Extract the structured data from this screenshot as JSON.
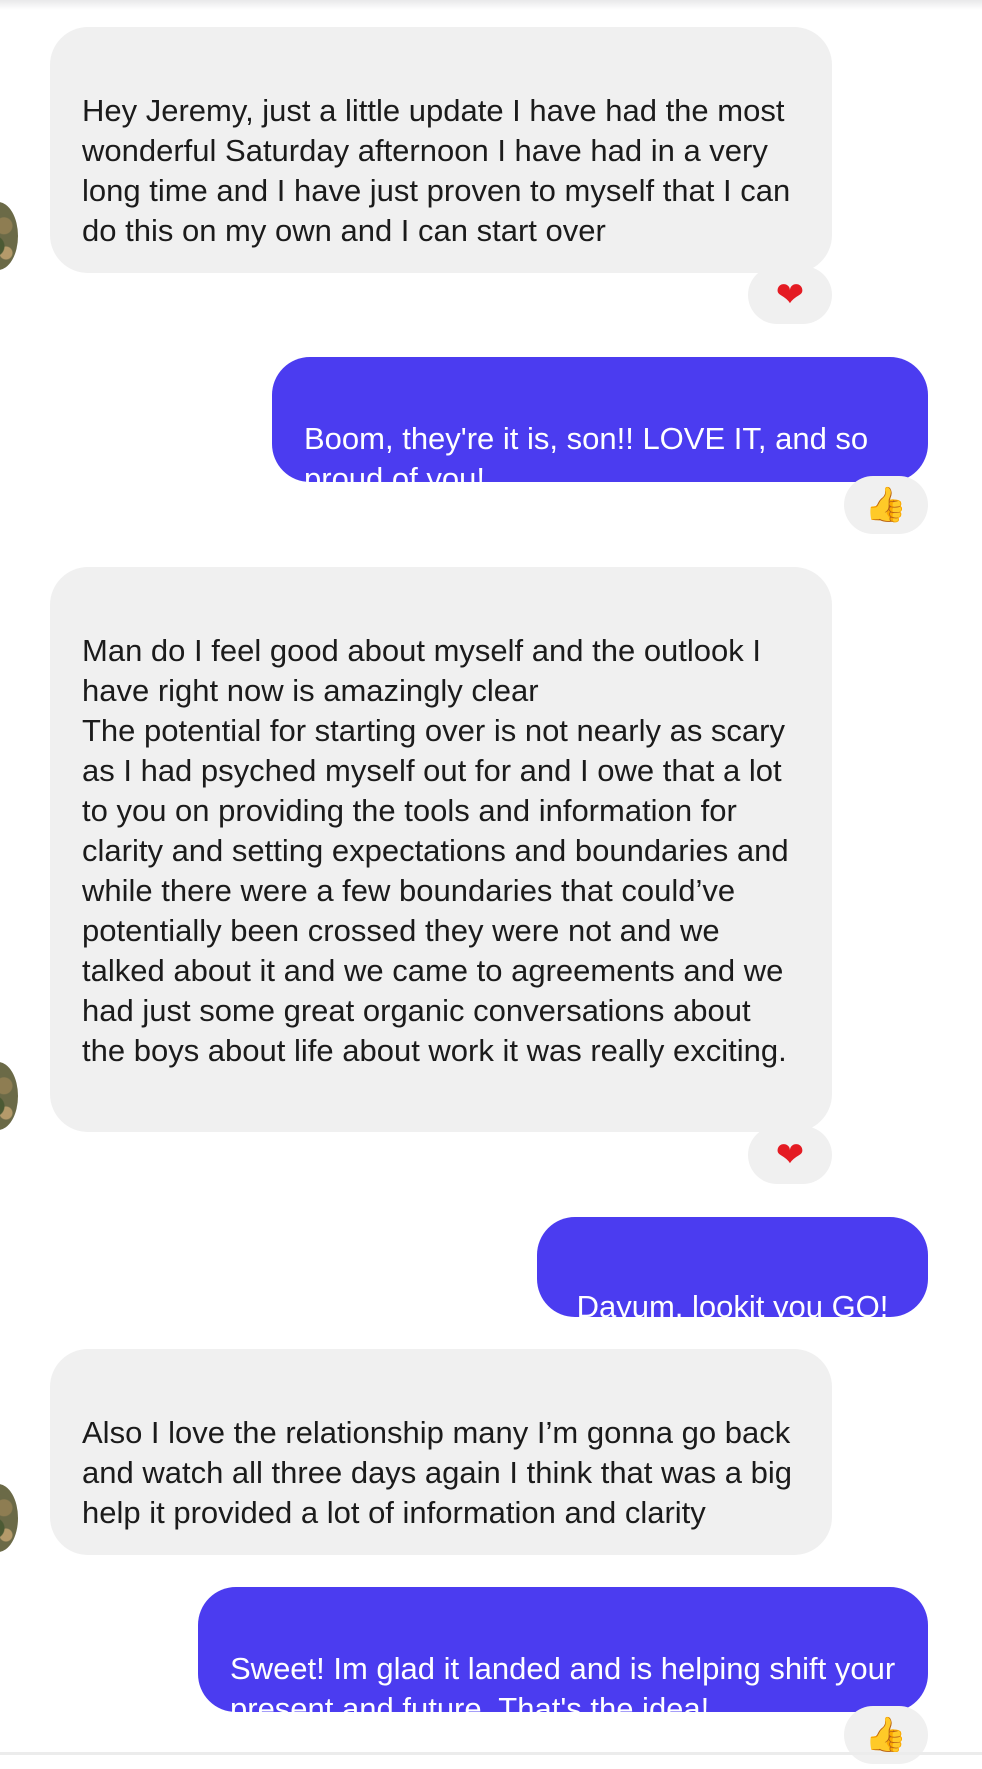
{
  "messages": [
    {
      "direction": "incoming",
      "text": "Hey Jeremy, just a little update I have had the most wonderful Saturday afternoon I have had in a very long time and I have just proven to myself that I can do this on my own and I can start over",
      "reaction": "heart",
      "reaction_glyph": "❤"
    },
    {
      "direction": "outgoing",
      "text": "Boom, they're it is, son!! LOVE IT, and so proud of you!",
      "reaction": "thumbs-up",
      "reaction_glyph": "👍"
    },
    {
      "direction": "incoming",
      "text": "Man do I feel good about myself and the outlook I have right now is amazingly clear\nThe potential for starting over is not nearly as scary as I had psyched myself out for and I owe that a lot to you on providing the tools and information for clarity and setting expectations and boundaries and while there were a few boundaries that could’ve potentially been crossed they were not and we talked about it and we came to agreements and we had just some great organic conversations about the boys about life about work it was really exciting.",
      "reaction": "heart",
      "reaction_glyph": "❤"
    },
    {
      "direction": "outgoing",
      "text": "Dayum, lookit you GO!"
    },
    {
      "direction": "incoming",
      "text": "Also I love the relationship many I’m gonna go back and watch all three days again I think that was a big help it provided a lot of information and clarity"
    },
    {
      "direction": "outgoing",
      "text": "Sweet! Im glad it landed and is helping shift your present and future. That's the idea!",
      "reaction": "thumbs-up",
      "reaction_glyph": "👍"
    }
  ],
  "colors": {
    "incoming_bubble": "#f0f0f0",
    "outgoing_bubble": "#4b3cf0",
    "heart": "#e41b23"
  }
}
